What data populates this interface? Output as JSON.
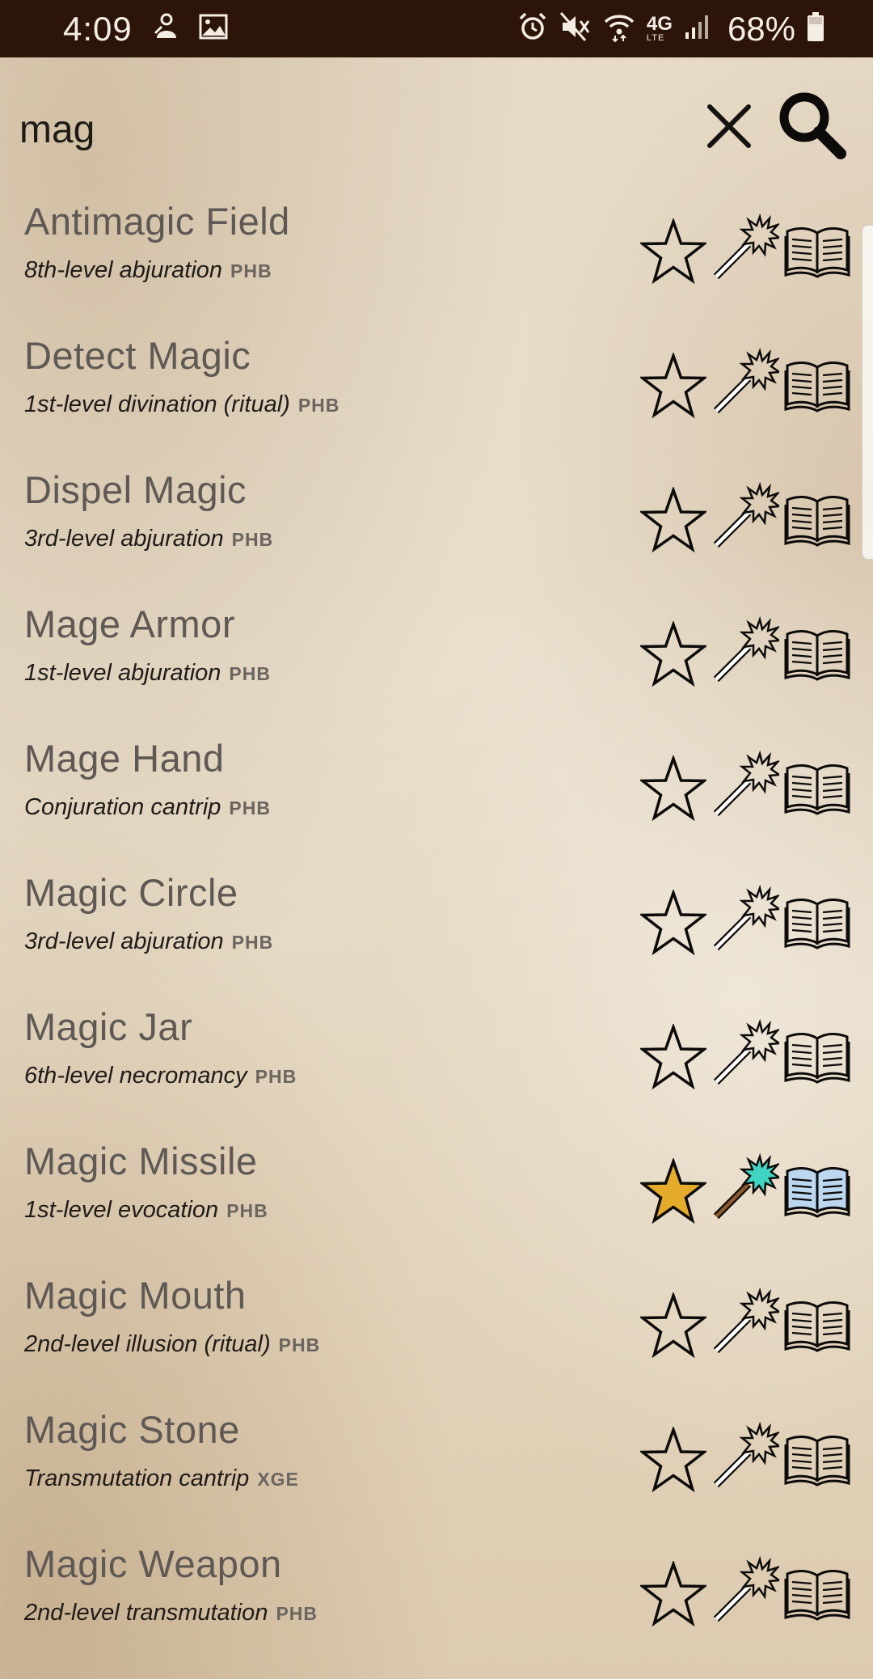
{
  "status_bar": {
    "time": "4:09",
    "battery": "68%",
    "left_icons": [
      "bixby-icon",
      "image-icon"
    ],
    "right_icons": [
      "alarm-icon",
      "mute-icon",
      "wifi-icon",
      "lte-icon",
      "signal-icon",
      "battery-icon"
    ],
    "network_label": "4G",
    "network_sub_label": "LTE"
  },
  "search": {
    "value": "mag",
    "clear_icon": "close-icon",
    "search_icon": "search-icon"
  },
  "colors": {
    "status_bar_bg": "#2d1408",
    "name_text": "#5f5955",
    "favorite_active_fill": "#e5ab2a",
    "prepared_active": "#3fd5c2",
    "known_active": "#bcd7f0"
  },
  "spells": [
    {
      "name": "Antimagic Field",
      "level": "8th-level abjuration",
      "source": "PHB",
      "favorite": false,
      "prepared": false,
      "known": false
    },
    {
      "name": "Detect Magic",
      "level": "1st-level divination (ritual)",
      "source": "PHB",
      "favorite": false,
      "prepared": false,
      "known": false
    },
    {
      "name": "Dispel Magic",
      "level": "3rd-level abjuration",
      "source": "PHB",
      "favorite": false,
      "prepared": false,
      "known": false
    },
    {
      "name": "Mage Armor",
      "level": "1st-level abjuration",
      "source": "PHB",
      "favorite": false,
      "prepared": false,
      "known": false
    },
    {
      "name": "Mage Hand",
      "level": "Conjuration cantrip",
      "source": "PHB",
      "favorite": false,
      "prepared": false,
      "known": false
    },
    {
      "name": "Magic Circle",
      "level": "3rd-level abjuration",
      "source": "PHB",
      "favorite": false,
      "prepared": false,
      "known": false
    },
    {
      "name": "Magic Jar",
      "level": "6th-level necromancy",
      "source": "PHB",
      "favorite": false,
      "prepared": false,
      "known": false
    },
    {
      "name": "Magic Missile",
      "level": "1st-level evocation",
      "source": "PHB",
      "favorite": true,
      "prepared": true,
      "known": true
    },
    {
      "name": "Magic Mouth",
      "level": "2nd-level illusion (ritual)",
      "source": "PHB",
      "favorite": false,
      "prepared": false,
      "known": false
    },
    {
      "name": "Magic Stone",
      "level": "Transmutation cantrip",
      "source": "XGE",
      "favorite": false,
      "prepared": false,
      "known": false
    },
    {
      "name": "Magic Weapon",
      "level": "2nd-level transmutation",
      "source": "PHB",
      "favorite": false,
      "prepared": false,
      "known": false
    }
  ]
}
